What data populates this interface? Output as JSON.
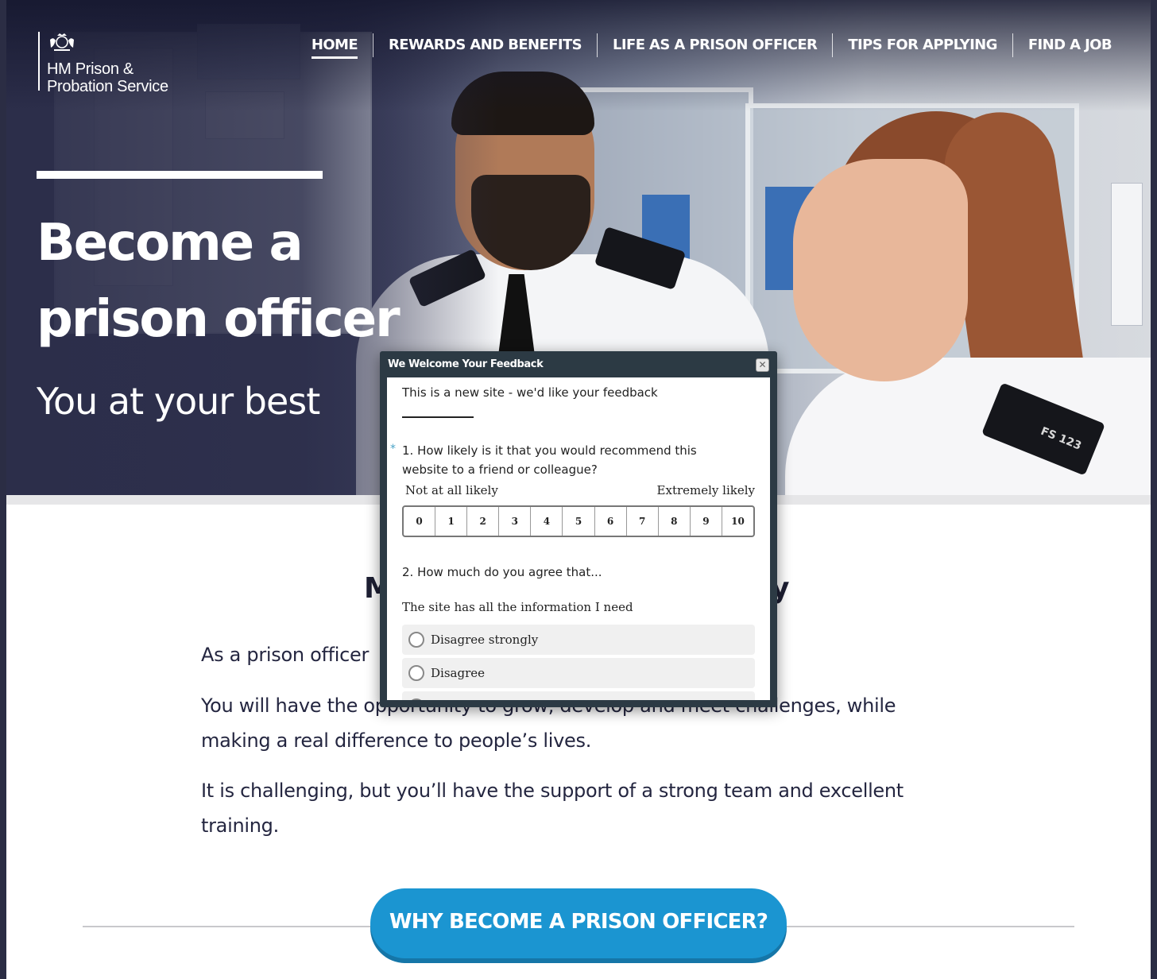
{
  "brand": {
    "logo_line1": "HM Prison &",
    "logo_line2": "Probation Service",
    "crest_icon": "royal-crest-icon"
  },
  "nav": {
    "items": [
      {
        "label": "HOME",
        "active": true
      },
      {
        "label": "REWARDS AND BENEFITS",
        "active": false
      },
      {
        "label": "LIFE AS A PRISON OFFICER",
        "active": false
      },
      {
        "label": "TIPS FOR APPLYING",
        "active": false
      },
      {
        "label": "FIND A JOB",
        "active": false
      }
    ]
  },
  "hero": {
    "title_line1": "Become a",
    "title_line2": "prison officer",
    "subtitle": "You at your best",
    "badge_text": "FS 123"
  },
  "main": {
    "section_title_left": "M",
    "section_title_right": "y",
    "paragraph1": "As a prison officer",
    "paragraph2": "You will have the opportunity to grow, develop and meet challenges, while making a real difference to people’s lives.",
    "paragraph3": "It is challenging, but you’ll have the support of a strong team and excellent training.",
    "cta_label": "WHY BECOME A PRISON OFFICER?"
  },
  "feedback_modal": {
    "title": "We Welcome Your Feedback",
    "close_icon": "close-icon",
    "intro": "This is a new site - we'd like your feedback",
    "required_marker": "*",
    "question1": "1. How likely is it that you would recommend this website to a friend or colleague?",
    "scale_low": "Not at all likely",
    "scale_high": "Extremely likely",
    "scale": [
      "0",
      "1",
      "2",
      "3",
      "4",
      "5",
      "6",
      "7",
      "8",
      "9",
      "10"
    ],
    "question2": "2. How much do you agree that...",
    "statement": "The site has all the information I need",
    "options": [
      "Disagree strongly",
      "Disagree"
    ]
  },
  "colors": {
    "accent": "#1b95d1",
    "modal_header": "#2c3a44",
    "hero_overlay": "#2f3150",
    "text_dark": "#242640"
  }
}
